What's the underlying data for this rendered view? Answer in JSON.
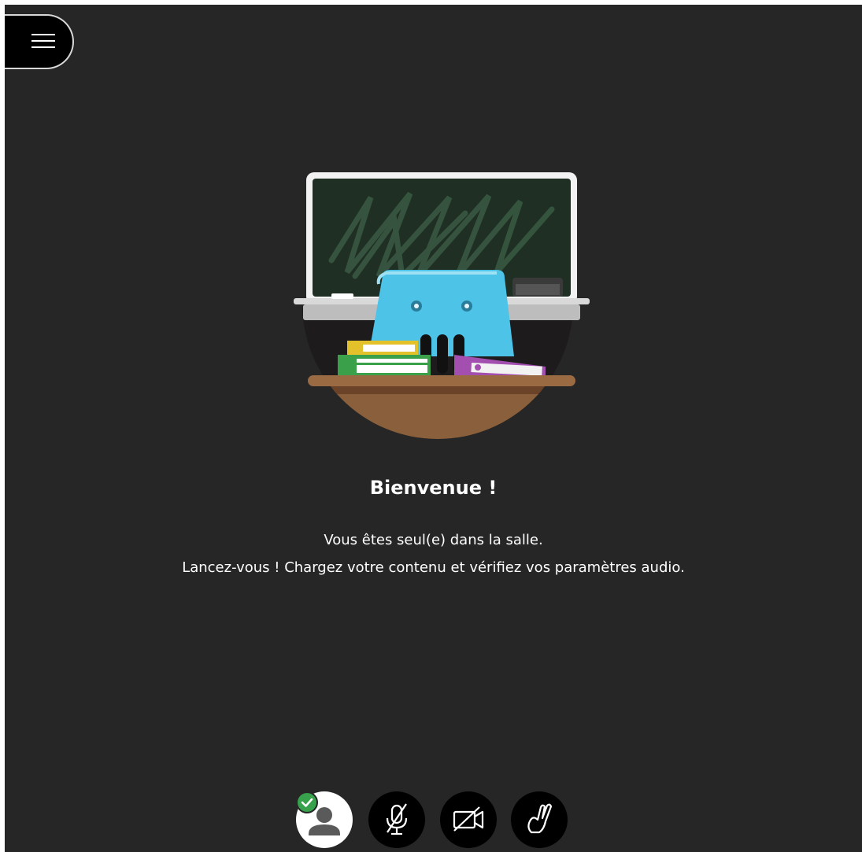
{
  "menu": {
    "icon": "hamburger-icon"
  },
  "welcome": {
    "title": "Bienvenue !",
    "line1": "Vous êtes seul(e) dans la salle.",
    "line2": "Lancez-vous ! Chargez votre contenu et vérifiez vos paramètres audio."
  },
  "controls": [
    {
      "name": "my-status-avatar",
      "icon": "user-avatar-icon",
      "badge": "check-icon",
      "badge_color": "#37a14b"
    },
    {
      "name": "microphone-toggle",
      "icon": "microphone-muted-icon"
    },
    {
      "name": "camera-toggle",
      "icon": "camera-off-icon"
    },
    {
      "name": "raise-hand",
      "icon": "raise-hand-icon"
    }
  ],
  "colors": {
    "background": "#262626",
    "text": "#ffffff",
    "control_bg": "#000000",
    "chalkboard": "#1f2f23",
    "desk": "#8a5f3b",
    "chair": "#4dc3e8"
  }
}
